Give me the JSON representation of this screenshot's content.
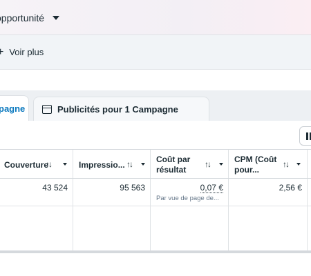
{
  "header": {
    "objective": "opportunité"
  },
  "more": {
    "label": "Voir plus"
  },
  "tabs": {
    "active_label": "pagne",
    "inactive_label": "Publicités pour 1 Campagne"
  },
  "table": {
    "columns": [
      {
        "label": "Couverture"
      },
      {
        "label": "Impressio..."
      },
      {
        "label": "Coût par résultat"
      },
      {
        "label": "CPM (Coût pour..."
      }
    ],
    "sort_glyph": "↑↓",
    "row": {
      "couverture": "43 524",
      "impressions": "95 563",
      "cout_par_resultat": "0,07 €",
      "cout_par_resultat_sub": "Par vue de page de...",
      "cpm": "2,56 €"
    }
  },
  "colors": {
    "accent": "#0a78be",
    "text": "#1c2b33",
    "muted": "#67788a"
  }
}
